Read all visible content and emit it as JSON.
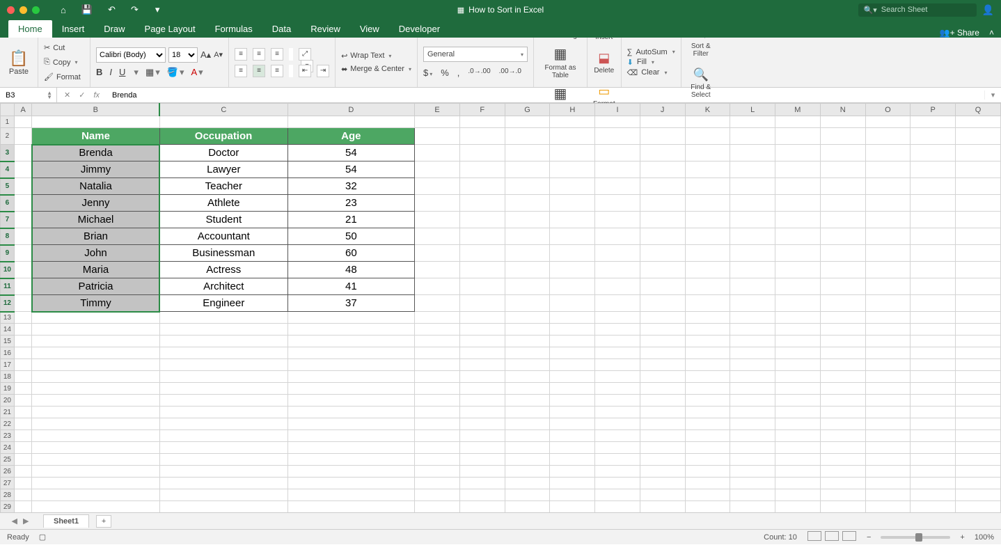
{
  "window": {
    "title": "How to Sort in Excel"
  },
  "search": {
    "placeholder": "Search Sheet"
  },
  "tabs": {
    "home": "Home",
    "insert": "Insert",
    "draw": "Draw",
    "page_layout": "Page Layout",
    "formulas": "Formulas",
    "data": "Data",
    "review": "Review",
    "view": "View",
    "developer": "Developer",
    "share": "Share"
  },
  "clipboard": {
    "paste": "Paste",
    "cut": "Cut",
    "copy": "Copy",
    "format": "Format"
  },
  "font": {
    "name": "Calibri (Body)",
    "size": "18",
    "bold": "B",
    "italic": "I",
    "underline": "U"
  },
  "alignment": {
    "wrap": "Wrap Text",
    "merge": "Merge & Center"
  },
  "number": {
    "format": "General"
  },
  "styles": {
    "cond": "Conditional Formatting",
    "table": "Format as Table",
    "cell": "Cell Styles"
  },
  "cells": {
    "insert": "Insert",
    "delete": "Delete",
    "format": "Format"
  },
  "editing": {
    "autosum": "AutoSum",
    "fill": "Fill",
    "clear": "Clear",
    "sort": "Sort & Filter",
    "find": "Find & Select"
  },
  "namebox": "B3",
  "formula": "Brenda",
  "fx_label": "fx",
  "sheet": {
    "columns": [
      "A",
      "B",
      "C",
      "D",
      "E",
      "F",
      "G",
      "H",
      "I",
      "J",
      "K",
      "L",
      "M",
      "N",
      "O",
      "P",
      "Q"
    ],
    "headers": {
      "b": "Name",
      "c": "Occupation",
      "d": "Age"
    },
    "rows": [
      {
        "name": "Brenda",
        "occupation": "Doctor",
        "age": "54"
      },
      {
        "name": "Jimmy",
        "occupation": "Lawyer",
        "age": "54"
      },
      {
        "name": "Natalia",
        "occupation": "Teacher",
        "age": "32"
      },
      {
        "name": "Jenny",
        "occupation": "Athlete",
        "age": "23"
      },
      {
        "name": "Michael",
        "occupation": "Student",
        "age": "21"
      },
      {
        "name": "Brian",
        "occupation": "Accountant",
        "age": "50"
      },
      {
        "name": "John",
        "occupation": "Businessman",
        "age": "60"
      },
      {
        "name": "Maria",
        "occupation": "Actress",
        "age": "48"
      },
      {
        "name": "Patricia",
        "occupation": "Architect",
        "age": "41"
      },
      {
        "name": "Timmy",
        "occupation": "Engineer",
        "age": "37"
      }
    ]
  },
  "sheet_tab": "Sheet1",
  "status": {
    "ready": "Ready",
    "count": "Count: 10",
    "zoom": "100%"
  }
}
